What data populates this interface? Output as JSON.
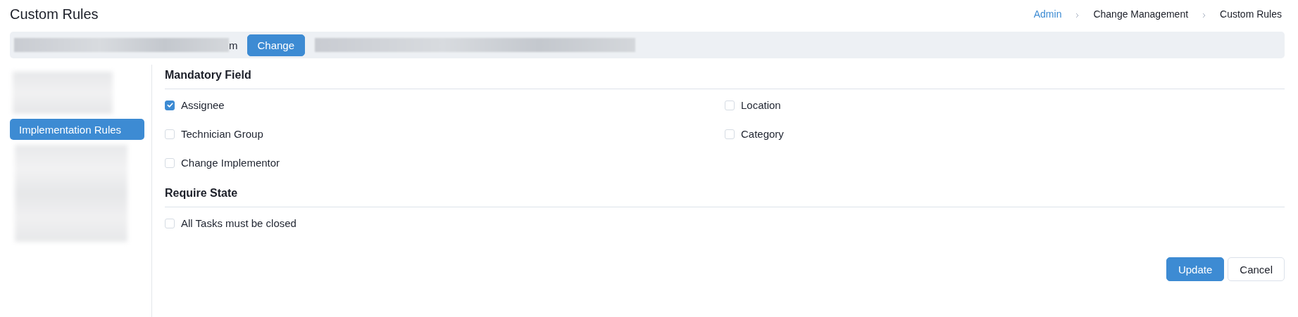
{
  "page": {
    "title": "Custom Rules"
  },
  "breadcrumb": [
    {
      "label": "Admin",
      "kind": "link"
    },
    {
      "label": "Change Management",
      "kind": "text"
    },
    {
      "label": "Custom Rules",
      "kind": "text"
    }
  ],
  "info_bar": {
    "fragment": "m",
    "button": "Change"
  },
  "sidebar": {
    "items": [
      {
        "label": "Implementation Rules",
        "selected": true
      }
    ]
  },
  "sections": [
    {
      "title": "Mandatory Field",
      "fields": [
        {
          "label": "Assignee",
          "checked": true
        },
        {
          "label": "Location",
          "checked": false
        },
        {
          "label": "Technician Group",
          "checked": false
        },
        {
          "label": "Category",
          "checked": false
        },
        {
          "label": "Change Implementor",
          "checked": false
        }
      ]
    },
    {
      "title": "Require State",
      "fields": [
        {
          "label": "All Tasks must be closed",
          "checked": false
        }
      ]
    }
  ],
  "buttons": [
    {
      "label": "Update",
      "kind": "primary"
    },
    {
      "label": "Cancel",
      "kind": "secondary"
    }
  ]
}
